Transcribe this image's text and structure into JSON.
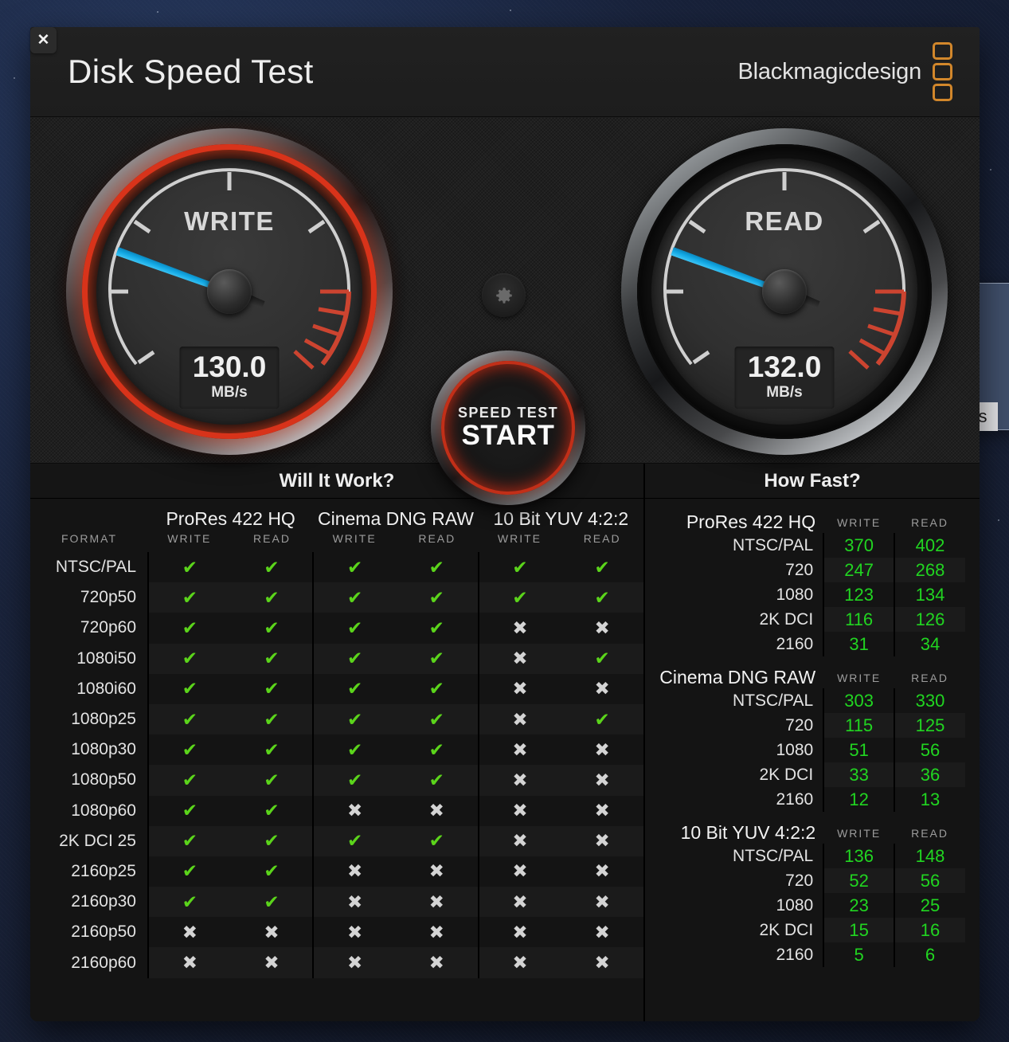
{
  "window": {
    "title": "Disk Speed Test",
    "close_label": "✕",
    "brand_text": "Blackmagicdesign"
  },
  "gauges": {
    "write": {
      "label": "WRITE",
      "value": "130.0",
      "unit": "MB/s",
      "needle_deg": 200
    },
    "read": {
      "label": "READ",
      "value": "132.0",
      "unit": "MB/s",
      "needle_deg": 200
    }
  },
  "start_button": {
    "top_label": "SPEED TEST",
    "main_label": "START"
  },
  "gear_button": {
    "icon": "gear-icon"
  },
  "will_it_work": {
    "title": "Will It Work?",
    "format_header": "FORMAT",
    "codecs": [
      "ProRes 422 HQ",
      "Cinema DNG RAW",
      "10 Bit YUV 4:2:2"
    ],
    "sub_headers": [
      "WRITE",
      "READ"
    ],
    "yes_glyph": "✔",
    "no_glyph": "✖",
    "rows": [
      {
        "format": "NTSC/PAL",
        "cells": [
          true,
          true,
          true,
          true,
          true,
          true
        ]
      },
      {
        "format": "720p50",
        "cells": [
          true,
          true,
          true,
          true,
          true,
          true
        ]
      },
      {
        "format": "720p60",
        "cells": [
          true,
          true,
          true,
          true,
          false,
          false
        ]
      },
      {
        "format": "1080i50",
        "cells": [
          true,
          true,
          true,
          true,
          false,
          true
        ]
      },
      {
        "format": "1080i60",
        "cells": [
          true,
          true,
          true,
          true,
          false,
          false
        ]
      },
      {
        "format": "1080p25",
        "cells": [
          true,
          true,
          true,
          true,
          false,
          true
        ]
      },
      {
        "format": "1080p30",
        "cells": [
          true,
          true,
          true,
          true,
          false,
          false
        ]
      },
      {
        "format": "1080p50",
        "cells": [
          true,
          true,
          true,
          true,
          false,
          false
        ]
      },
      {
        "format": "1080p60",
        "cells": [
          true,
          true,
          false,
          false,
          false,
          false
        ]
      },
      {
        "format": "2K DCI 25",
        "cells": [
          true,
          true,
          true,
          true,
          false,
          false
        ]
      },
      {
        "format": "2160p25",
        "cells": [
          true,
          true,
          false,
          false,
          false,
          false
        ]
      },
      {
        "format": "2160p30",
        "cells": [
          true,
          true,
          false,
          false,
          false,
          false
        ]
      },
      {
        "format": "2160p50",
        "cells": [
          false,
          false,
          false,
          false,
          false,
          false
        ]
      },
      {
        "format": "2160p60",
        "cells": [
          false,
          false,
          false,
          false,
          false,
          false
        ]
      }
    ]
  },
  "how_fast": {
    "title": "How Fast?",
    "col_write": "WRITE",
    "col_read": "READ",
    "groups": [
      {
        "name": "ProRes 422 HQ",
        "rows": [
          {
            "label": "NTSC/PAL",
            "write": "370",
            "read": "402"
          },
          {
            "label": "720",
            "write": "247",
            "read": "268"
          },
          {
            "label": "1080",
            "write": "123",
            "read": "134"
          },
          {
            "label": "2K DCI",
            "write": "116",
            "read": "126"
          },
          {
            "label": "2160",
            "write": "31",
            "read": "34"
          }
        ]
      },
      {
        "name": "Cinema DNG RAW",
        "rows": [
          {
            "label": "NTSC/PAL",
            "write": "303",
            "read": "330"
          },
          {
            "label": "720",
            "write": "115",
            "read": "125"
          },
          {
            "label": "1080",
            "write": "51",
            "read": "56"
          },
          {
            "label": "2K DCI",
            "write": "33",
            "read": "36"
          },
          {
            "label": "2160",
            "write": "12",
            "read": "13"
          }
        ]
      },
      {
        "name": "10 Bit YUV 4:2:2",
        "rows": [
          {
            "label": "NTSC/PAL",
            "write": "136",
            "read": "148"
          },
          {
            "label": "720",
            "write": "52",
            "read": "56"
          },
          {
            "label": "1080",
            "write": "23",
            "read": "25"
          },
          {
            "label": "2K DCI",
            "write": "15",
            "read": "16"
          },
          {
            "label": "2160",
            "write": "5",
            "read": "6"
          }
        ]
      }
    ]
  },
  "background_window": {
    "tab_label": "s"
  },
  "colors": {
    "accent_red": "#d8331a",
    "brand_orange": "#d2872b",
    "needle_blue": "#12a8e4",
    "check_green": "#5bd41b",
    "number_green": "#21d521"
  }
}
